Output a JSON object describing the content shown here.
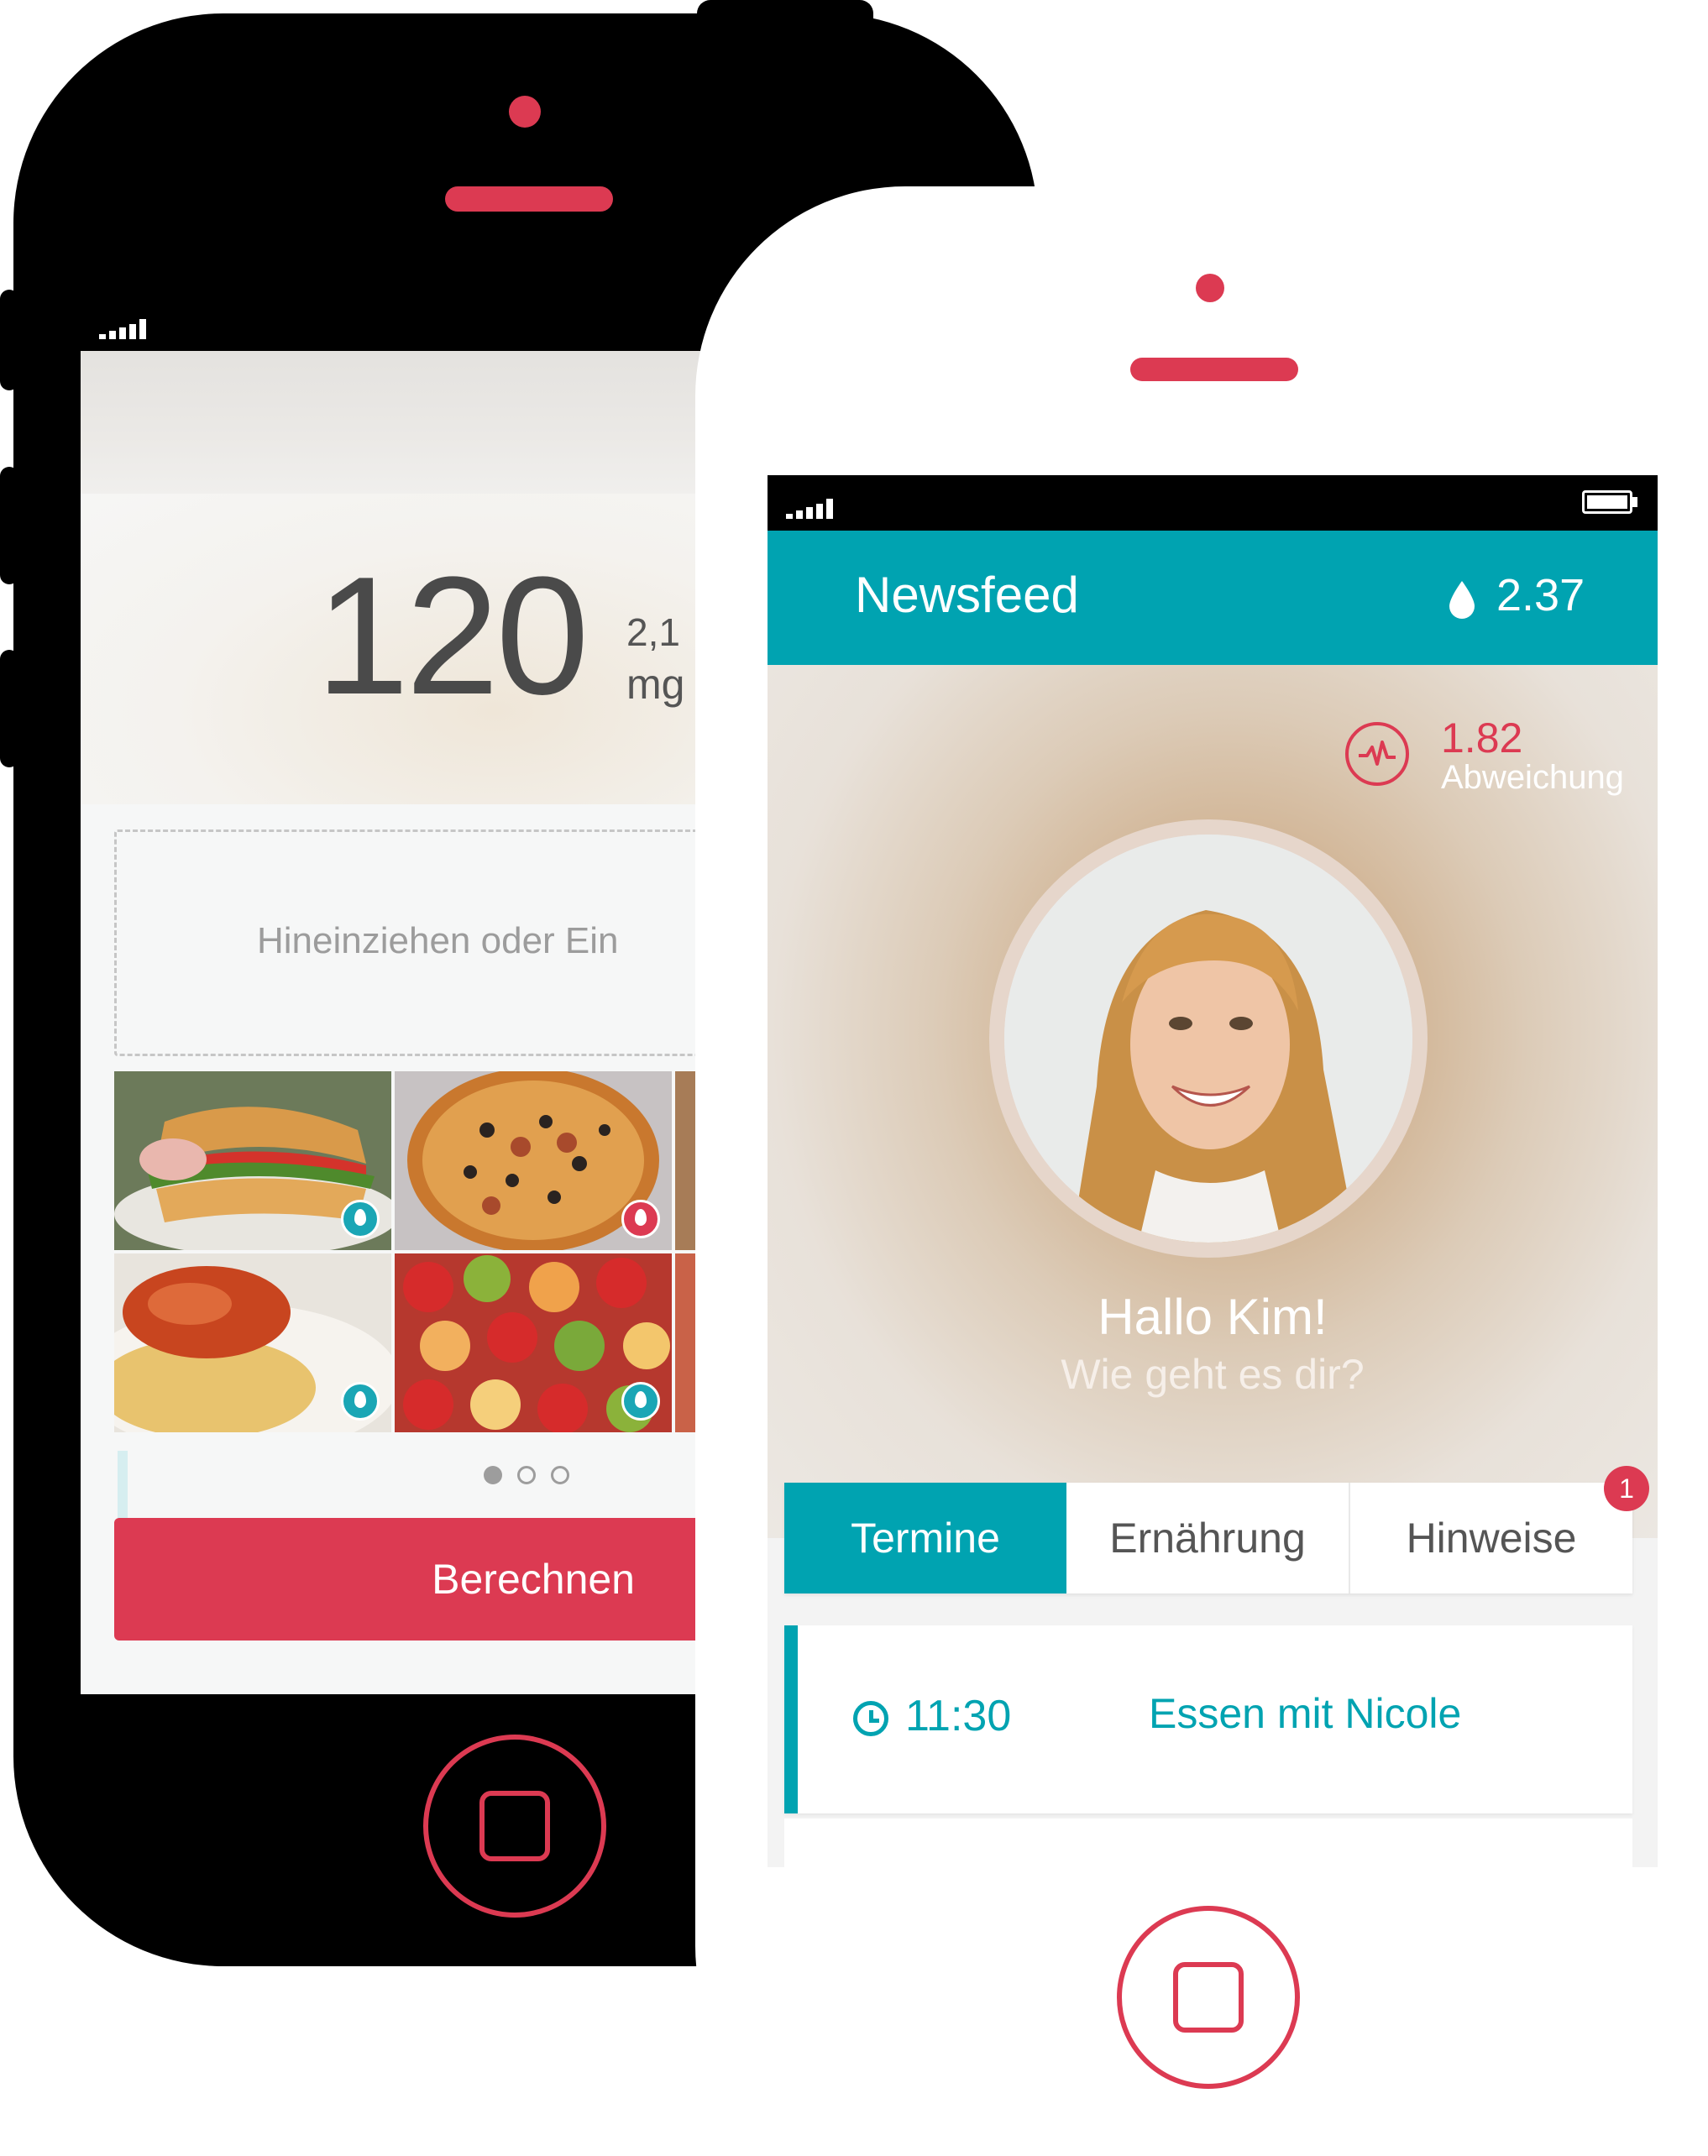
{
  "colors": {
    "accent_red": "#dc3a52",
    "accent_teal": "#00a3b1",
    "phone_black": "#000000",
    "phone_white": "#ffffff"
  },
  "left_phone": {
    "reading": {
      "value": "120",
      "ratio": "2,1",
      "unit": "mg"
    },
    "dropzone_text": "Hineinziehen oder Ein",
    "food_items": [
      {
        "name": "sandwich",
        "badge": "drop-icon",
        "badge_color": "#1aa6b5"
      },
      {
        "name": "pizza",
        "badge": "drop-icon",
        "badge_color": "#dc3a52"
      },
      {
        "name": "spaghetti",
        "badge": "drop-icon",
        "badge_color": "#1aa6b5"
      },
      {
        "name": "fruit-salad",
        "badge": "drop-icon",
        "badge_color": "#1aa6b5"
      }
    ],
    "pager": {
      "pages": 3,
      "active_index": 0
    },
    "calculate_button": "Berechnen"
  },
  "right_phone": {
    "header": {
      "title": "Newsfeed",
      "icon": "drop-icon",
      "value": "2.37"
    },
    "deviation": {
      "icon": "heartbeat-icon",
      "value": "1.82",
      "label": "Abweichung"
    },
    "greeting": "Hallo Kim!",
    "subtitle": "Wie geht es dir?",
    "tabs": [
      {
        "label": "Termine",
        "active": true
      },
      {
        "label": "Ernährung",
        "active": false
      },
      {
        "label": "Hinweise",
        "active": false
      }
    ],
    "notification_count": "1",
    "appointments": [
      {
        "icon": "clock-icon",
        "time": "11:30",
        "title": "Essen mit Nicole"
      }
    ]
  }
}
